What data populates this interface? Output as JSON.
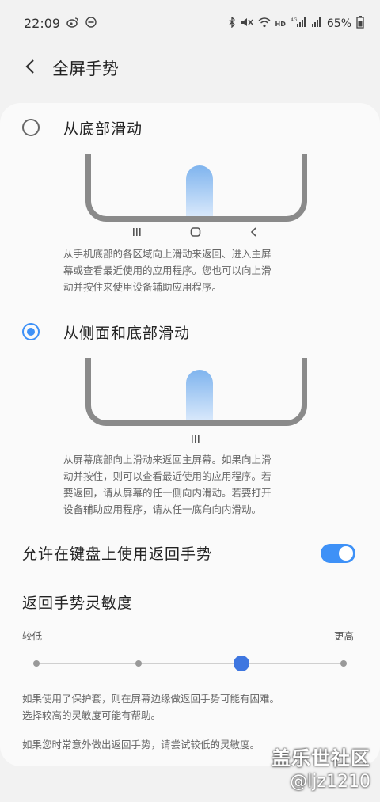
{
  "status_bar": {
    "time": "22:09",
    "battery_percent": "65%",
    "left_icons": [
      "weibo-icon",
      "dnd-icon"
    ],
    "right_icons": [
      "bluetooth-icon",
      "mute-icon",
      "wifi-icon",
      "hd-icon",
      "4g-signal-icon",
      "signal-icon",
      "battery-icon"
    ]
  },
  "header": {
    "title": "全屏手势"
  },
  "options": [
    {
      "title": "从底部滑动",
      "selected": false,
      "desc_lines": [
        "从手机底部的各区域向上滑动来返回、进入主屏",
        "幕或查看最近使用的应用程序。您也可以向上滑",
        "动并按住来使用设备辅助应用程序。"
      ]
    },
    {
      "title": "从侧面和底部滑动",
      "selected": true,
      "desc_lines": [
        "从屏幕底部向上滑动来返回主屏幕。如果向上滑",
        "动并按住，则可以查看最近使用的应用程序。若",
        "要返回，请从屏幕的任一侧向内滑动。若要打开",
        "设备辅助应用程序，请从任一底角向内滑动。"
      ]
    }
  ],
  "keyboard_toggle": {
    "label": "允许在键盘上使用返回手势",
    "on": true
  },
  "sensitivity": {
    "title": "返回手势灵敏度",
    "low_label": "较低",
    "high_label": "更高",
    "steps": 4,
    "selected_step": 3,
    "note1_lines": [
      "如果使用了保护套，则在屏幕边缘做返回手势可能有困难。",
      "选择较高的灵敏度可能有帮助。"
    ],
    "note2_line": "如果您时常意外做出返回手势，请尝试较低的灵敏度。"
  },
  "watermark": {
    "line1": "盖乐世社区",
    "line2": "@ljz1210"
  },
  "colors": {
    "accent": "#3e91f7",
    "slider_thumb": "#3e76e0"
  }
}
